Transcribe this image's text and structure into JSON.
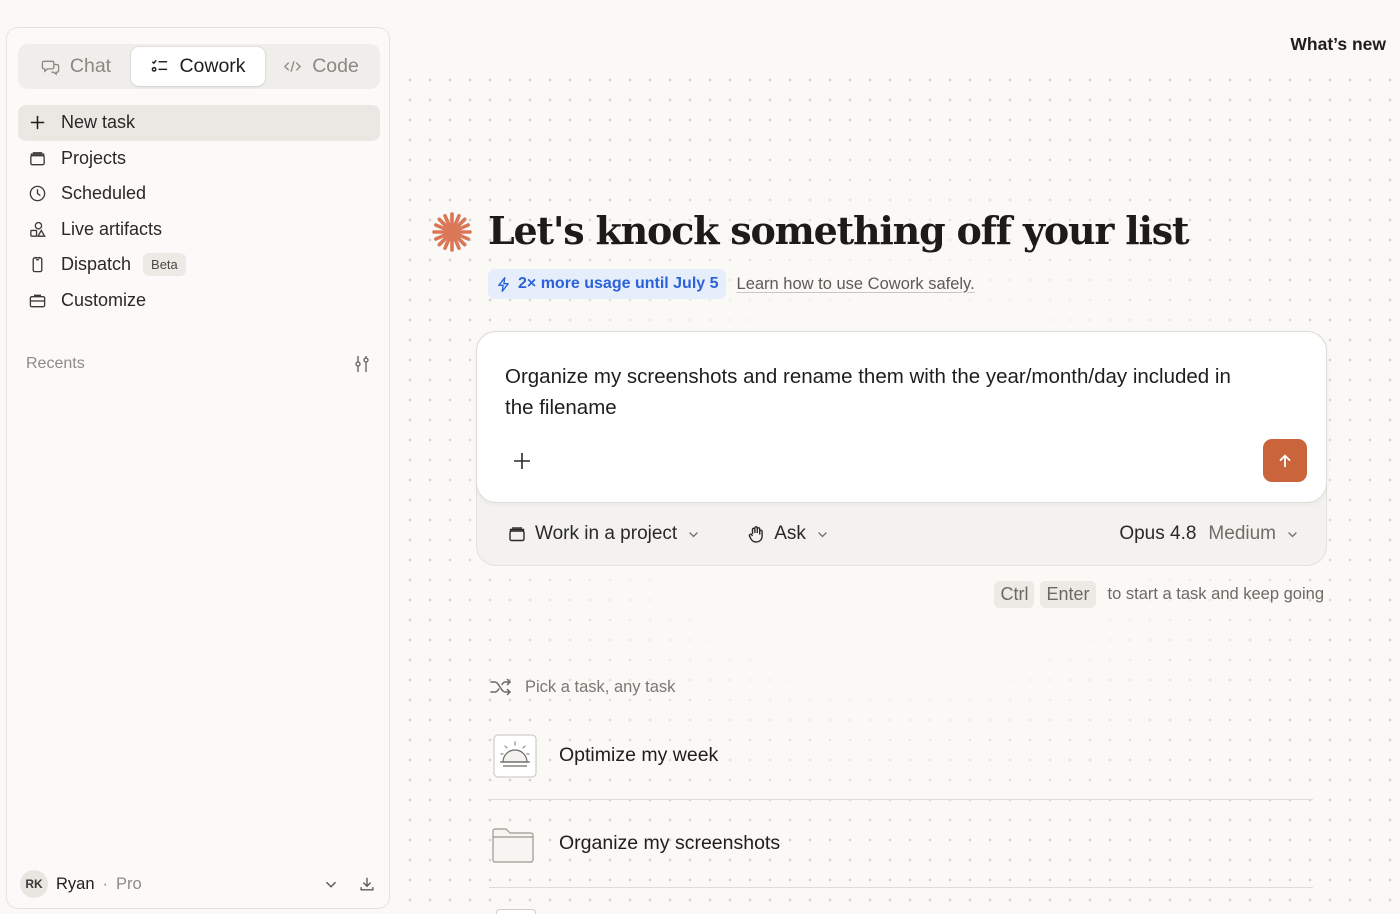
{
  "mode_tabs": [
    {
      "label": "Chat",
      "icon": "chat-bubbles-icon",
      "active": false
    },
    {
      "label": "Cowork",
      "icon": "checklist-icon",
      "active": true
    },
    {
      "label": "Code",
      "icon": "code-brackets-icon",
      "active": false
    }
  ],
  "nav": [
    {
      "label": "New task",
      "icon": "plus-icon",
      "active": true
    },
    {
      "label": "Projects",
      "icon": "folder-box-icon"
    },
    {
      "label": "Scheduled",
      "icon": "clock-icon"
    },
    {
      "label": "Live artifacts",
      "icon": "shapes-icon"
    },
    {
      "label": "Dispatch",
      "icon": "phone-icon",
      "badge": "Beta"
    },
    {
      "label": "Customize",
      "icon": "briefcase-icon"
    }
  ],
  "recents": {
    "label": "Recents",
    "icon": "filter-sliders-icon"
  },
  "user": {
    "initials": "RK",
    "name": "Ryan",
    "separator": "·",
    "plan": "Pro"
  },
  "header": {
    "whats_new": "What’s new"
  },
  "hero": {
    "title": "Let's knock something off your list",
    "icon": "sunburst-logo-icon",
    "accent_color": "#d97757"
  },
  "promo": {
    "badge": "2× more usage until July 5",
    "link": "Learn how to use Cowork safely."
  },
  "composer": {
    "text": "Organize my screenshots and rename them with the year/month/day included in the filename",
    "send_color": "#c9643b"
  },
  "options": {
    "project": "Work in a project",
    "mode": "Ask",
    "model": "Opus 4.8",
    "effort": "Medium"
  },
  "shortcut": {
    "key1": "Ctrl",
    "key2": "Enter",
    "hint": "to start a task and keep going"
  },
  "pick": {
    "label": "Pick a task, any task"
  },
  "tasks": [
    {
      "label": "Optimize my week",
      "icon": "sunrise-icon"
    },
    {
      "label": "Organize my screenshots",
      "icon": "folder-icon"
    }
  ]
}
